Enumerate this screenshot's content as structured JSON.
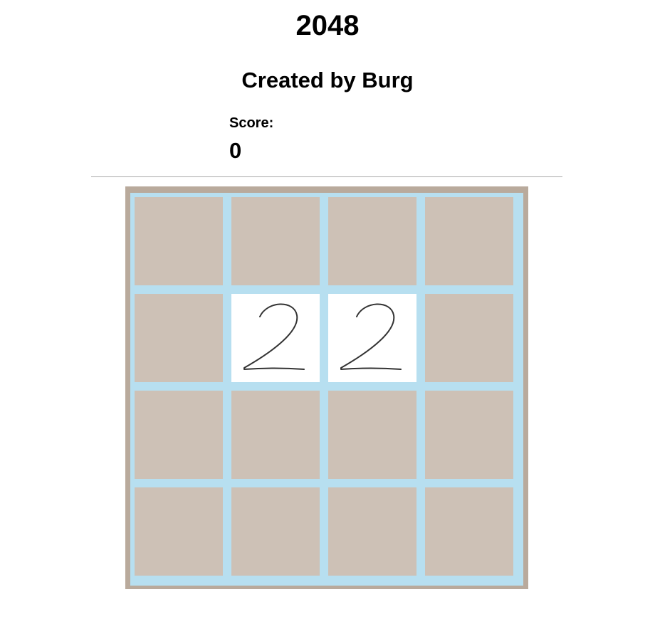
{
  "header": {
    "title": "2048",
    "subtitle": "Created by Burg"
  },
  "score": {
    "label": "Score:",
    "value": "0"
  },
  "board": {
    "rows": 4,
    "cols": 4,
    "tiles": [
      [
        "",
        "",
        "",
        ""
      ],
      [
        "",
        "2",
        "2",
        ""
      ],
      [
        "",
        "",
        "",
        ""
      ],
      [
        "",
        "",
        "",
        ""
      ]
    ],
    "colors": {
      "board_frame": "#b9aa9c",
      "grid_lines": "#b7dff0",
      "empty_cell": "#cdc1b6",
      "tile": "#ffffff",
      "digit_stroke": "#333333"
    }
  }
}
